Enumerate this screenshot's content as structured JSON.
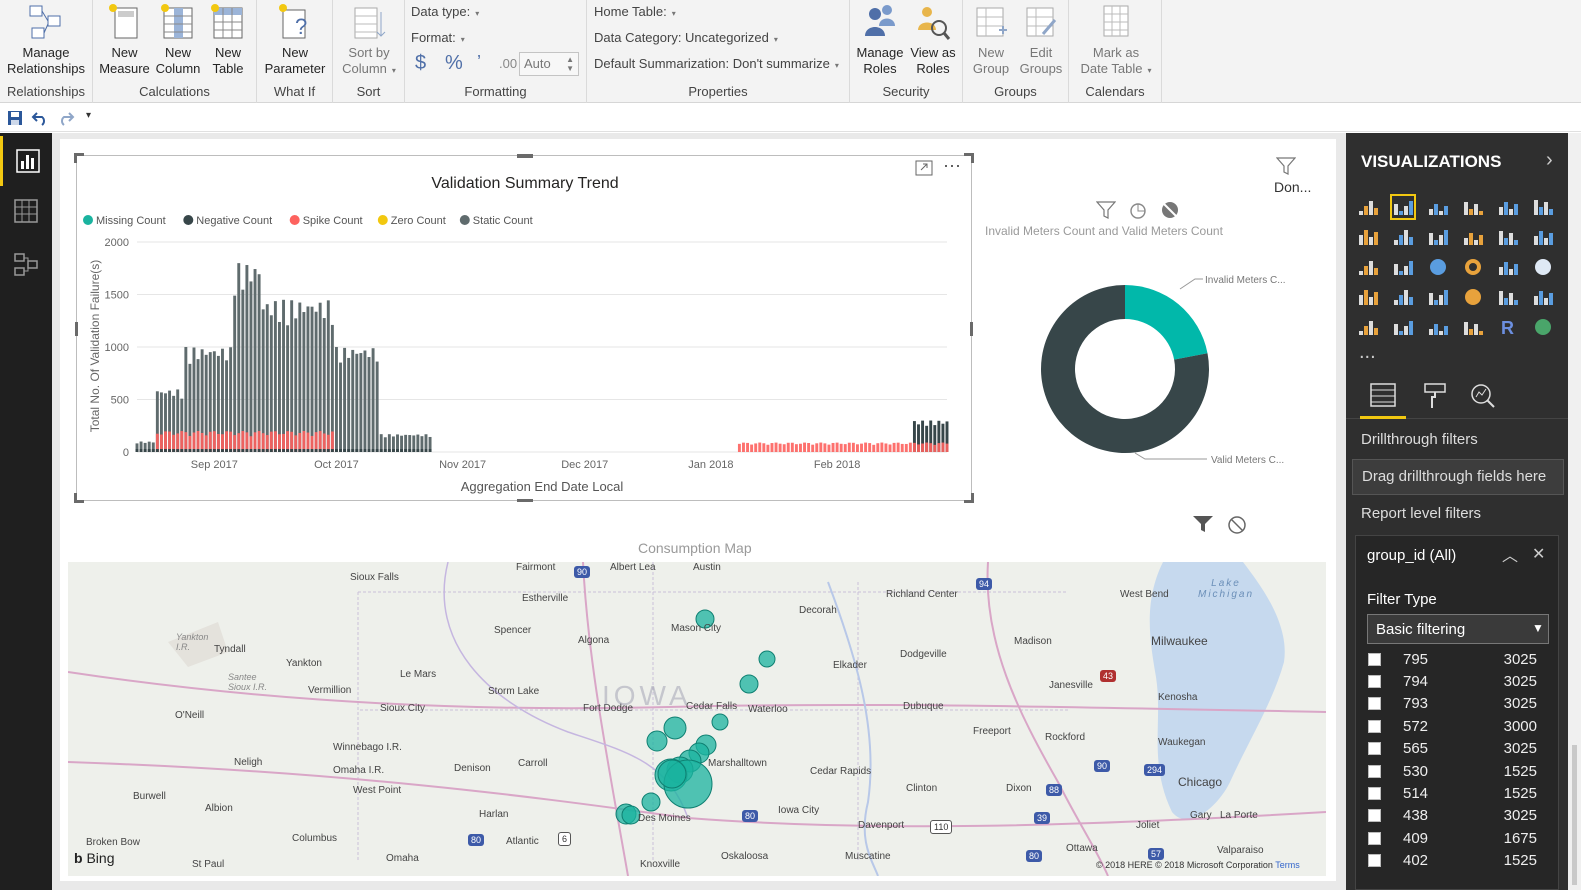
{
  "ribbon": {
    "groups": [
      {
        "label": "Relationships",
        "buttons": [
          {
            "line1": "Manage",
            "line2": "Relationships"
          }
        ]
      },
      {
        "label": "Calculations",
        "buttons": [
          {
            "line1": "New",
            "line2": "Measure"
          },
          {
            "line1": "New",
            "line2": "Column"
          },
          {
            "line1": "New",
            "line2": "Table"
          }
        ]
      },
      {
        "label": "What If",
        "buttons": [
          {
            "line1": "New",
            "line2": "Parameter"
          }
        ]
      },
      {
        "label": "Sort",
        "buttons": [
          {
            "line1": "Sort by",
            "line2": "Column"
          }
        ]
      },
      {
        "label": "Formatting"
      },
      {
        "label": "Properties"
      },
      {
        "label": "Security",
        "buttons": [
          {
            "line1": "Manage",
            "line2": "Roles"
          },
          {
            "line1": "View as",
            "line2": "Roles"
          }
        ]
      },
      {
        "label": "Groups",
        "buttons": [
          {
            "line1": "New",
            "line2": "Group"
          },
          {
            "line1": "Edit",
            "line2": "Groups"
          }
        ]
      },
      {
        "label": "Calendars",
        "buttons": [
          {
            "line1": "Mark as",
            "line2": "Date Table"
          }
        ]
      }
    ],
    "formatting": {
      "data_type": "Data type:",
      "format": "Format:",
      "currency": "$",
      "percent": "%",
      "comma": "’",
      "decimals": ".00",
      "auto": "Auto"
    },
    "properties": {
      "home_table": "Home Table:",
      "data_category": "Data Category: Uncategorized",
      "default_summarization": "Default Summarization: Don't summarize"
    }
  },
  "trend": {
    "title": "Validation Summary Trend",
    "legend": [
      {
        "name": "Missing Count",
        "color": "#1ab39f"
      },
      {
        "name": "Negative Count",
        "color": "#374649"
      },
      {
        "name": "Spike Count",
        "color": "#fd625e"
      },
      {
        "name": "Zero Count",
        "color": "#f2c80f"
      },
      {
        "name": "Static Count",
        "color": "#5f6b6d"
      }
    ],
    "ylabel": "Total No. Of Validation Failure(s)",
    "xlabel": "Aggregation End Date Local",
    "yticks": [
      "2000",
      "1500",
      "1000",
      "500",
      "0"
    ],
    "xticks": [
      "Sep 2017",
      "Oct 2017",
      "Nov 2017",
      "Dec 2017",
      "Jan 2018",
      "Feb 2018"
    ]
  },
  "chart_data": [
    {
      "type": "bar",
      "title": "Validation Summary Trend",
      "xlabel": "Aggregation End Date Local",
      "ylabel": "Total No. Of Validation Failure(s)",
      "ylim": [
        0,
        2000
      ],
      "x_start": "2017-08-13",
      "x_end": "2018-02-28",
      "series": [
        {
          "name": "Static Count",
          "color": "#5f6b6d",
          "segments": [
            {
              "from": "2017-08-13",
              "to": "2017-08-17",
              "level": 100
            },
            {
              "from": "2017-08-18",
              "to": "2017-08-24",
              "level": 600
            },
            {
              "from": "2017-08-25",
              "to": "2017-09-05",
              "level": 1000
            },
            {
              "from": "2017-09-06",
              "to": "2017-09-12",
              "level": 1800
            },
            {
              "from": "2017-09-13",
              "to": "2017-09-30",
              "level": 1450
            },
            {
              "from": "2017-10-01",
              "to": "2017-10-11",
              "level": 1000
            },
            {
              "from": "2017-10-12",
              "to": "2017-10-24",
              "level": 170
            }
          ]
        },
        {
          "name": "Spike Count",
          "color": "#fd625e",
          "segments": [
            {
              "from": "2017-08-18",
              "to": "2017-09-30",
              "level": 200
            },
            {
              "from": "2018-01-08",
              "to": "2018-02-28",
              "level": 90
            }
          ]
        },
        {
          "name": "Static Count (Feb 2018)",
          "color": "#5f6b6d",
          "segments": [
            {
              "from": "2018-02-20",
              "to": "2018-02-28",
              "level": 300
            }
          ]
        }
      ]
    },
    {
      "type": "pie",
      "title": "Invalid Meters Count and Valid Meters Count",
      "labels": [
        "Invalid Meters C...",
        "Valid Meters C..."
      ],
      "values": [
        22,
        78
      ],
      "colors": [
        "#01b8aa",
        "#374649"
      ]
    }
  ],
  "donut": {
    "title": "Invalid Meters Count and Valid Meters Count",
    "label_invalid": "Invalid Meters C...",
    "label_valid": "Valid Meters C...",
    "done_label": "Don..."
  },
  "map": {
    "title": "Consumption Map",
    "bing": "Bing",
    "copyright": "© 2018 HERE © 2018 Microsoft Corporation",
    "terms": "Terms",
    "places": [
      "Sioux Falls",
      "Fairmont",
      "Albert Lea",
      "Austin",
      "Estherville",
      "Spencer",
      "Algona",
      "Mason City",
      "Decorah",
      "Richland Center",
      "West Bend",
      "Yankton",
      "Tyndall",
      "Le Mars",
      "Vermillion",
      "Sioux City",
      "Storm Lake",
      "Fort Dodge",
      "Cedar Falls",
      "Waterloo",
      "Elkader",
      "Dodgeville",
      "Madison",
      "Janesville",
      "Milwaukee",
      "Kenosha",
      "Waukegan",
      "Chicago",
      "O'Neill",
      "Neligh",
      "Winnebago I.R.",
      "Omaha I.R.",
      "West Point",
      "Denison",
      "Carroll",
      "Marshalltown",
      "Cedar Rapids",
      "Dubuque",
      "Freeport",
      "Rockford",
      "Burwell",
      "Albion",
      "Harlan",
      "Des Moines",
      "Iowa City",
      "Clinton",
      "Davenport",
      "Dixon",
      "Joliet",
      "Gary",
      "La Porte",
      "Broken Bow",
      "Columbus",
      "Omaha",
      "Atlantic",
      "Oskaloosa",
      "Knoxville",
      "Muscatine",
      "Ottawa",
      "Valparaiso",
      "St Paul",
      "IOWA",
      "Lake Michigan",
      "Santee Sioux I.R.",
      "Yankton I.R."
    ]
  },
  "viz_pane": {
    "title": "VISUALIZATIONS",
    "more": "...",
    "drillthrough": "Drillthrough filters",
    "drag_here": "Drag drillthrough fields here",
    "report_filters": "Report level filters",
    "filter_card": {
      "field": "group_id (All)",
      "filter_type_label": "Filter Type",
      "filter_type_value": "Basic filtering"
    },
    "filter_values": [
      {
        "id": "795",
        "count": "3025"
      },
      {
        "id": "794",
        "count": "3025"
      },
      {
        "id": "793",
        "count": "3025"
      },
      {
        "id": "572",
        "count": "3000"
      },
      {
        "id": "565",
        "count": "3025"
      },
      {
        "id": "530",
        "count": "1525"
      },
      {
        "id": "514",
        "count": "1525"
      },
      {
        "id": "438",
        "count": "3025"
      },
      {
        "id": "409",
        "count": "1675"
      },
      {
        "id": "402",
        "count": "1525"
      }
    ]
  }
}
